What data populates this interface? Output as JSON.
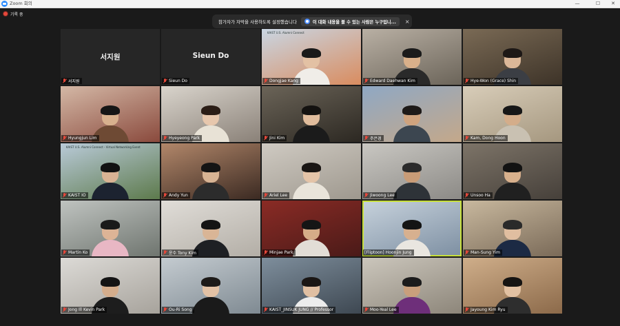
{
  "window": {
    "title": "Zoom 회의",
    "controls": [
      "—",
      "☐",
      "✕"
    ]
  },
  "recording": {
    "label": "기록 중",
    "color": "#e5483b"
  },
  "notification": {
    "message": "참가자가 자막을 사용하도록 설정했습니다",
    "chip_text": "이 대화 내용을 볼 수 있는 사람은 누구입니...",
    "close": "×"
  },
  "colors": {
    "background": "#1a1a1a",
    "active_speaker_outline": "#c8e03a",
    "muted": "#e5483b"
  },
  "participants": [
    {
      "name": "서지원",
      "display": "서지원",
      "video": false,
      "muted": true
    },
    {
      "name": "Sieun Do",
      "display": "Sieun Do",
      "video": false,
      "muted": true
    },
    {
      "name": "Dongjae Kang",
      "video": true,
      "muted": true,
      "banner": "KAIST U.S. Alumni Connect",
      "bg": [
        "#c9d6e3",
        "#d98c5f"
      ],
      "skin": "#e3c1a4",
      "hair": "#1a1a1a",
      "shirt": "#f0ede8"
    },
    {
      "name": "Edward Daehwan Kim",
      "video": true,
      "muted": true,
      "bg": [
        "#b9b0a4",
        "#6b6459"
      ],
      "skin": "#d9b08a",
      "hair": "#1b1b1b",
      "shirt": "#2a2a2a"
    },
    {
      "name": "Hye-Won (Grace) Shin",
      "video": true,
      "muted": true,
      "bg": [
        "#7a6a55",
        "#3d3328"
      ],
      "skin": "#dbb798",
      "hair": "#1d1816",
      "shirt": "#3b3e44"
    },
    {
      "name": "Hyungjun Lim",
      "video": true,
      "muted": true,
      "bg": [
        "#d4b8a6",
        "#8a4a3d"
      ],
      "skin": "#d8b18e",
      "hair": "#161616",
      "shirt": "#6e4a34"
    },
    {
      "name": "Hyeyeong Park",
      "video": true,
      "muted": true,
      "bg": [
        "#d9d4cc",
        "#8a8178"
      ],
      "skin": "#e7c7ad",
      "hair": "#2b1d16",
      "shirt": "#e8e2d6"
    },
    {
      "name": "Jini Kim",
      "video": true,
      "muted": true,
      "bg": [
        "#6b6458",
        "#2c2822"
      ],
      "skin": "#e0bc9c",
      "hair": "#141210",
      "shirt": "#1b1b1b"
    },
    {
      "name": "주은경",
      "video": true,
      "muted": true,
      "bg": [
        "#8fa8c4",
        "#c4a88a"
      ],
      "skin": "#cfa37e",
      "hair": "#1e1a18",
      "shirt": "#3c4650"
    },
    {
      "name": "Kam, Dong Hoon",
      "video": true,
      "muted": true,
      "bg": [
        "#d8cdb9",
        "#a5977f"
      ],
      "skin": "#d4ad8a",
      "hair": "#171717",
      "shirt": "#c9c1b2"
    },
    {
      "name": "KAIST IO",
      "video": true,
      "muted": true,
      "banner": "KAIST U.S. Alumni Connect - Virtual Networking Event",
      "bg": [
        "#b9cad8",
        "#5d7a4c"
      ],
      "skin": "#d9b394",
      "hair": "#121212",
      "shirt": "#1c2330"
    },
    {
      "name": "Andy Yun",
      "video": true,
      "muted": true,
      "bg": [
        "#b2876a",
        "#3b2a22"
      ],
      "skin": "#d8b494",
      "hair": "#141414",
      "shirt": "#2c2c2c"
    },
    {
      "name": "Ariel Lee",
      "video": true,
      "muted": true,
      "bg": [
        "#cfcac2",
        "#9e988e"
      ],
      "skin": "#e4c4a8",
      "hair": "#1a1614",
      "shirt": "#e9e4da"
    },
    {
      "name": "Jiwoong Lee",
      "video": true,
      "muted": true,
      "bg": [
        "#c9c7c2",
        "#8c8a86"
      ],
      "skin": "#c99c77",
      "hair": "#2b2b2b",
      "shirt": "#2e3338"
    },
    {
      "name": "Unsoo Ha",
      "video": true,
      "muted": true,
      "bg": [
        "#7d7468",
        "#46403a"
      ],
      "skin": "#d8b08c",
      "hair": "#121212",
      "shirt": "#202020"
    },
    {
      "name": "Martin Ko",
      "video": true,
      "muted": true,
      "bg": [
        "#bfc3c0",
        "#6f756f"
      ],
      "skin": "#dcb496",
      "hair": "#1a1a1a",
      "shirt": "#e8b7c4"
    },
    {
      "name": "윤수 Tony Kim",
      "video": true,
      "muted": true,
      "bg": [
        "#e0ddd8",
        "#b3aea6"
      ],
      "skin": "#d9b596",
      "hair": "#141414",
      "shirt": "#1e2024"
    },
    {
      "name": "Minjae Park",
      "video": true,
      "muted": true,
      "bg": [
        "#8a2b25",
        "#4a1a18"
      ],
      "skin": "#d6ac88",
      "hair": "#151515",
      "shirt": "#e2ddd6"
    },
    {
      "name": "[Fliptoon] Hoonjin Jung",
      "video": true,
      "muted": false,
      "active": true,
      "bg": [
        "#c7d2dc",
        "#7d8fa2"
      ],
      "skin": "#d7b08f",
      "hair": "#141414",
      "shirt": "#e9e6e0"
    },
    {
      "name": "Man-Sung Yim",
      "video": true,
      "muted": true,
      "bg": [
        "#c8b89e",
        "#7a6a58"
      ],
      "skin": "#e0bea0",
      "hair": "#2a2a2a",
      "shirt": "#1c2a44"
    },
    {
      "name": "Jong Ill Kevin Park",
      "video": true,
      "muted": true,
      "bg": [
        "#dcdad6",
        "#a7a39c"
      ],
      "skin": "#d4ad8c",
      "hair": "#141414",
      "shirt": "#1d1d1d"
    },
    {
      "name": "Ou-Ri Song",
      "video": true,
      "muted": true,
      "bg": [
        "#c4cbd0",
        "#7f8a92"
      ],
      "skin": "#e3c2a5",
      "hair": "#1d1a18",
      "shirt": "#1a1a1a"
    },
    {
      "name": "KAIST_JINSUK JUNG // Professor",
      "video": true,
      "muted": true,
      "bg": [
        "#7e8e9c",
        "#3e4852"
      ],
      "skin": "#e0bfa2",
      "hair": "#1a1614",
      "shirt": "#ececec"
    },
    {
      "name": "Moo-Yeal Lee",
      "video": true,
      "muted": true,
      "bg": [
        "#cbc6bc",
        "#8d867a"
      ],
      "skin": "#c99f7c",
      "hair": "#1c1c1c",
      "shirt": "#6e2f7a"
    },
    {
      "name": "Jayoung Kim Ryu",
      "video": true,
      "muted": true,
      "bg": [
        "#cfae8a",
        "#8c6a4a"
      ],
      "skin": "#e2c1a2",
      "hair": "#161412",
      "shirt": "#2e2e2e"
    }
  ]
}
